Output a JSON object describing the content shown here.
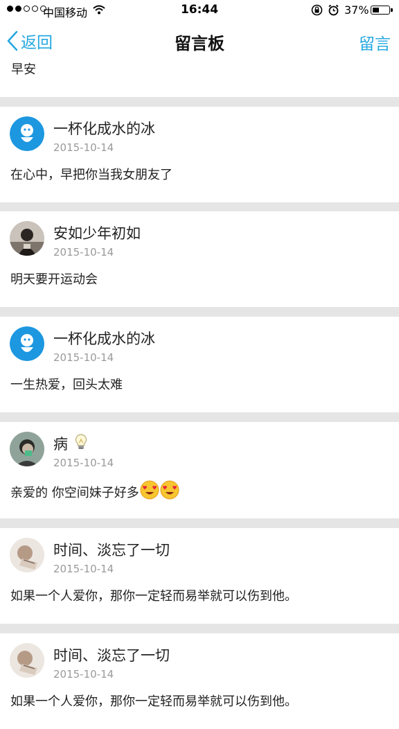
{
  "status_bar": {
    "carrier": "中国移动",
    "time": "16:44",
    "battery": "37%",
    "signal_bars_filled": 2,
    "signal_bars_total": 5,
    "battery_level": 0.37
  },
  "nav": {
    "back_label": "返回",
    "title": "留言板",
    "post_label": "留言"
  },
  "top_message": "早安",
  "messages": [
    {
      "username": "一杯化成水的冰",
      "date": "2015-10-14",
      "text": "在心中，早把你当我女朋友了",
      "avatar": "blue-cartoon-avatar"
    },
    {
      "username": "安如少年初如",
      "date": "2015-10-14",
      "text": "明天要开运动会",
      "avatar": "photo-avatar-dark"
    },
    {
      "username": "一杯化成水的冰",
      "date": "2015-10-14",
      "text": "一生热爱，回头太难",
      "avatar": "blue-cartoon-avatar"
    },
    {
      "username": "病",
      "date": "2015-10-14",
      "text": "亲爱的 你空间妹子好多",
      "avatar": "photo-avatar-person",
      "name_icon": "lightbulb-icon",
      "text_emojis": [
        "heart-eyes-emoji",
        "heart-eyes-emoji"
      ]
    },
    {
      "username": "时间、淡忘了一切",
      "date": "2015-10-14",
      "text": "如果一个人爱你，那你一定轻而易举就可以伤到他。",
      "avatar": "photo-avatar-light"
    },
    {
      "username": "时间、淡忘了一切",
      "date": "2015-10-14",
      "text": "如果一个人爱你，那你一定轻而易举就可以伤到他。",
      "avatar": "photo-avatar-light"
    }
  ],
  "colors": {
    "accent": "#25a8e0",
    "date_gray": "#9a9a9a",
    "separator": "#e5e5e5"
  }
}
